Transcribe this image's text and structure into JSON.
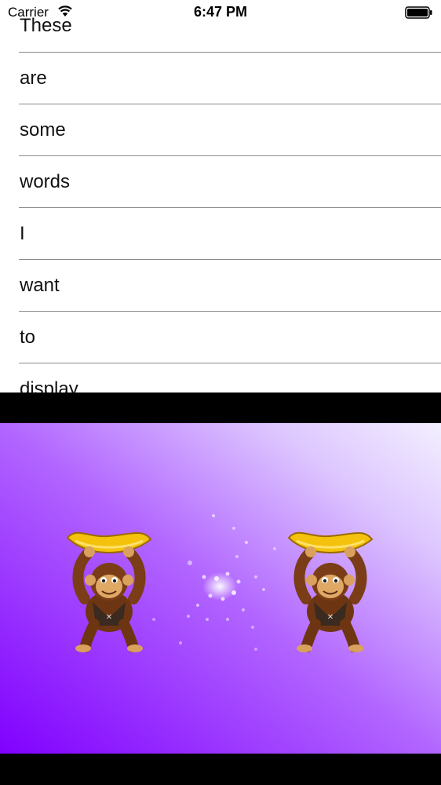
{
  "status_bar": {
    "carrier": "Carrier",
    "time": "6:47 PM",
    "wifi_icon": "wifi-icon",
    "battery_icon": "battery-icon"
  },
  "word_list": {
    "items": [
      "These",
      "are",
      "some",
      "words",
      "I",
      "want",
      "to",
      "display"
    ]
  },
  "game": {
    "background_colors": [
      "#8000ff",
      "#b266ff",
      "#f3efff"
    ],
    "sprites": [
      "monkey-with-banana-icon",
      "sparkle-particles",
      "monkey-with-banana-icon"
    ]
  }
}
